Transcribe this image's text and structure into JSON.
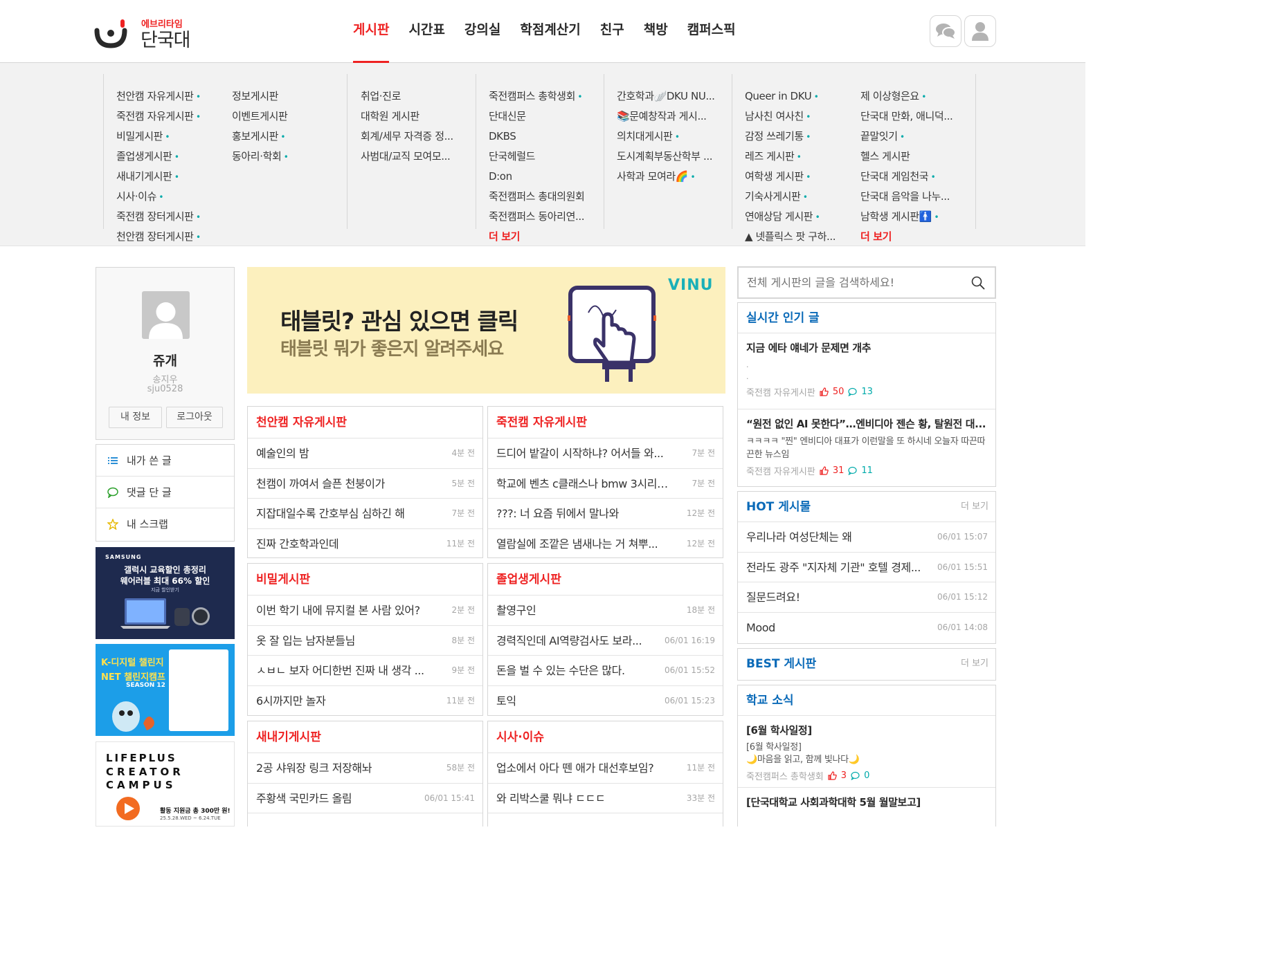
{
  "header": {
    "logo_sub": "에브리타임",
    "logo_main": "단국대",
    "nav": [
      "게시판",
      "시간표",
      "강의실",
      "학점계산기",
      "친구",
      "책방",
      "캠퍼스픽"
    ],
    "nav_active": "게시판",
    "icons": [
      "chat-icon",
      "user-icon"
    ]
  },
  "submenu": {
    "col1a": [
      "천안캠 자유게시판",
      "죽전캠 자유게시판",
      "비밀게시판",
      "졸업생게시판",
      "새내기게시판",
      "시사·이슈",
      "죽전캠 장터게시판",
      "천안캠 장터게시판"
    ],
    "col1b": [
      "정보게시판",
      "이벤트게시판",
      "홍보게시판",
      "동아리·학회"
    ],
    "col2": [
      "취업·진로",
      "대학원 게시판",
      "회계/세무 자격증 정...",
      "사범대/교직 모여모..."
    ],
    "col3": [
      "죽전캠퍼스 총학생회",
      "단대신문",
      "DKBS",
      "단국헤럴드",
      "D:on",
      "죽전캠퍼스 총대의원회",
      "죽전캠퍼스 동아리연...",
      "더 보기"
    ],
    "col4": [
      "간호학과🪽DKU NU...",
      "📚문예창작과 게시...",
      "의치대게시판",
      "도시계획부동산학부 ...",
      "사학과 모여라🌈"
    ],
    "col5a": [
      "Queer in DKU",
      "남사친 여사친",
      "감정 쓰레기통",
      "레즈 게시판",
      "여학생 게시판",
      "기숙사게시판",
      "연애상담 게시판",
      "▲ 넷플릭스 팟 구하..."
    ],
    "col5b": [
      "제 이상형은요",
      "단국대 만화, 애니덕...",
      "끝말잇기",
      "헬스 게시판",
      "단국대 게임천국",
      "단국대 음악을 나누...",
      "남학생 게시판🚹",
      "더 보기"
    ]
  },
  "profile": {
    "nickname": "쥬개",
    "name": "송지우",
    "user_id": "sju0528",
    "btn_info": "내 정보",
    "btn_logout": "로그아웃"
  },
  "mymenu": [
    "내가 쓴 글",
    "댓글 단 글",
    "내 스크랩"
  ],
  "ads": {
    "samsung_brand": "SAMSUNG",
    "samsung_line1": "갤럭시 교육할인 총정리",
    "samsung_line2": "웨어러블 최대 66% 할인",
    "samsung_line3": "지금 할인받기",
    "kdigital_line1": "K-디지털 챌린지",
    "kdigital_line2": "NET 챌린지캠프",
    "kdigital_season": "SEASON 12",
    "lifeplus_line1": "LIFEPLUS",
    "lifeplus_line2": "CREATOR",
    "lifeplus_line3": "CAMPUS",
    "lifeplus_prize": "활동 지원금 총 300만 원!",
    "lifeplus_date": "25.5.28.WED ~ 6.24.TUE"
  },
  "banner": {
    "title": "태블릿? 관심 있으면 클릭",
    "subtitle": "태블릿 뭐가 좋은지 알려주세요",
    "brand": "VINU"
  },
  "boards": [
    {
      "title": "천안캠 자유게시판",
      "rows": [
        [
          "예술인의 밤",
          "4분 전"
        ],
        [
          "천캠이 까여서 슬픈 천붕이가",
          "5분 전"
        ],
        [
          "지잡대일수록 간호부심 심하긴 해",
          "7분 전"
        ],
        [
          "진짜 간호학과인데",
          "11분 전"
        ]
      ]
    },
    {
      "title": "죽전캠 자유게시판",
      "rows": [
        [
          "드디어 밭갈이 시작하냐? 어서들 와...",
          "7분 전"
        ],
        [
          "학교에 벤츠 c클래스나 bmw 3시리즈...",
          "7분 전"
        ],
        [
          "???: 너 요즘 뒤에서 말나와",
          "12분 전"
        ],
        [
          "열람실에 조깥은 냄새나는 거 쳐뿌...",
          "12분 전"
        ]
      ]
    },
    {
      "title": "비밀게시판",
      "rows": [
        [
          "이번 학기 내에 뮤지컬 본 사람 있어?",
          "2분 전"
        ],
        [
          "옷 잘 입는 남자분들님",
          "8분 전"
        ],
        [
          "ㅅㅂㄴ 보자 어디한번 진짜 내 생각 ...",
          "9분 전"
        ],
        [
          "6시까지만 놀자",
          "11분 전"
        ]
      ]
    },
    {
      "title": "졸업생게시판",
      "rows": [
        [
          "촬영구인",
          "18분 전"
        ],
        [
          "경력직인데 AI역량검사도 보라...",
          "06/01 16:19"
        ],
        [
          "돈을 벌 수 있는 수단은 많다.",
          "06/01 15:52"
        ],
        [
          "토익",
          "06/01 15:23"
        ]
      ]
    },
    {
      "title": "새내기게시판",
      "rows": [
        [
          "2공 샤워장 링크 저장해놔",
          "58분 전"
        ],
        [
          "주황색 국민카드 올림",
          "06/01 15:41"
        ]
      ]
    },
    {
      "title": "시사·이슈",
      "rows": [
        [
          "업소에서 아다 뗀 애가 대선후보임?",
          "11분 전"
        ],
        [
          "와 리박스쿨 뭐냐 ㄷㄷㄷ",
          "33분 전"
        ]
      ]
    }
  ],
  "search": {
    "placeholder": "전체 게시판의 글을 검색하세요!"
  },
  "realtime": {
    "title": "실시간 인기 글",
    "posts": [
      {
        "title": "지금 에타 얘네가 문제면 개추",
        "content": ".\n.",
        "board": "죽전캠 자유게시판",
        "votes": "50",
        "comments": "13"
      },
      {
        "title": "“원전 없인 AI 못한다”…엔비디아 젠슨 황, 탈원전 대...",
        "content": "ㅋㅋㅋㅋ \"찐\" 엔비디아 대표가 이런말을 또 하시네 오늘자 따끈따끈한 뉴스임",
        "board": "죽전캠 자유게시판",
        "votes": "31",
        "comments": "11"
      }
    ]
  },
  "hot": {
    "title": "HOT 게시물",
    "more": "더 보기",
    "rows": [
      [
        "우리나라 여성단체는 왜",
        "06/01 15:07"
      ],
      [
        "전라도 광주 \"지자체 기관\" 호텔 경제...",
        "06/01 15:51"
      ],
      [
        "질문드려요!",
        "06/01 15:12"
      ],
      [
        "Mood",
        "06/01 14:08"
      ]
    ]
  },
  "best": {
    "title": "BEST 게시판",
    "more": "더 보기"
  },
  "school": {
    "title": "학교 소식",
    "posts": [
      {
        "title": "[6월 학사일정]",
        "content1": "[6월 학사일정]",
        "content2": "🌙마음을 읽고, 함께 빛나다🌙",
        "board": "죽전캠퍼스 총학생회",
        "votes": "3",
        "comments": "0"
      },
      {
        "title": "[단국대학교 사회과학대학 5월 월말보고]"
      }
    ]
  },
  "colors": {
    "accent": "#e22222",
    "link_blue": "#0a6ab8",
    "teal": "#00aaaa"
  }
}
